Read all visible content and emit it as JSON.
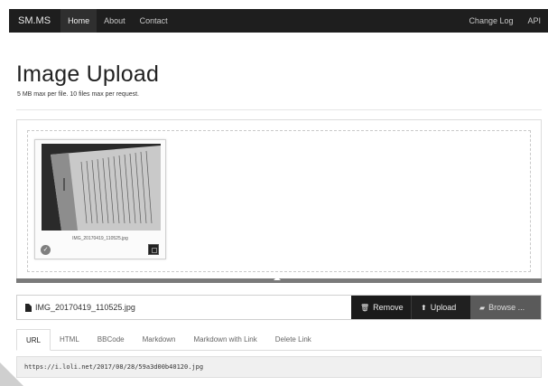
{
  "navbar": {
    "brand": "SM.MS",
    "links": [
      "Home",
      "About",
      "Contact"
    ],
    "active": "Home",
    "right_links": [
      "Change Log",
      "API"
    ]
  },
  "header": {
    "title": "Image Upload",
    "subtitle": "5 MB max per file. 10 files max per request."
  },
  "preview": {
    "filename": "IMG_20170419_110525.jpg",
    "status_icon": "check-circle-icon",
    "zoom_icon": "zoom-icon"
  },
  "upload": {
    "progress": 1.0,
    "file_field": "IMG_20170419_110525.jpg",
    "remove_label": "Remove",
    "upload_label": "Upload",
    "browse_label": "Browse ..."
  },
  "tabs": [
    "URL",
    "HTML",
    "BBCode",
    "Markdown",
    "Markdown with Link",
    "Delete Link"
  ],
  "active_tab": "URL",
  "output": {
    "url": "https://i.loli.net/2017/08/28/59a3d00b40120.jpg"
  },
  "colors": {
    "navbar": "#1e1e1e",
    "button_dark": "#1b1b1b",
    "button_browse": "#5a5a5a",
    "progress": "#7a7a7a"
  }
}
